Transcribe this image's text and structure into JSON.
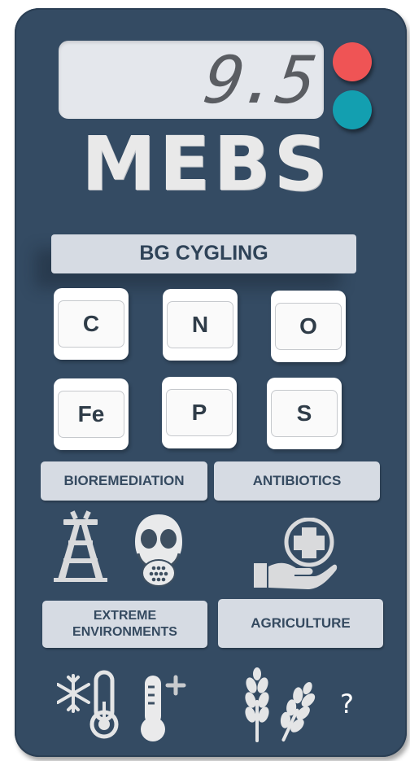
{
  "display": {
    "value": "9.5"
  },
  "brand": {
    "title": "MEBS"
  },
  "mode": {
    "label": "BG CYGLING"
  },
  "elements": [
    {
      "symbol": "C"
    },
    {
      "symbol": "N"
    },
    {
      "symbol": "O"
    },
    {
      "symbol": "Fe"
    },
    {
      "symbol": "P"
    },
    {
      "symbol": "S"
    }
  ],
  "categories": {
    "bioremediation": "BIOREMEDIATION",
    "antibiotics": "ANTIBIOTICS",
    "extreme_line1": "EXTREME",
    "extreme_line2": "ENVIRONMENTS",
    "agriculture": "AGRICULTURE"
  },
  "help": {
    "label": "?"
  },
  "icons": [
    "oil-derrick-icon",
    "gas-mask-icon",
    "hand-medical-cross-icon",
    "snowflake-thermometer-icon",
    "thermometer-plus-icon",
    "wheat-icon"
  ],
  "colors": {
    "body": "#344b63",
    "led_red": "#ef5455",
    "led_teal": "#139fb0",
    "label_bg": "#d6dbe3"
  }
}
